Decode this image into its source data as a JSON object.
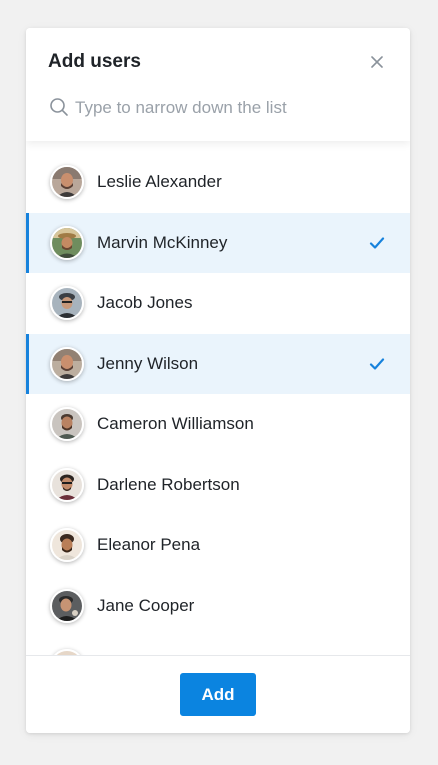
{
  "dialog": {
    "title": "Add users",
    "search_placeholder": "Type to narrow down the list",
    "add_label": "Add"
  },
  "colors": {
    "accent": "#0b84e0",
    "selected_row_bg": "#eaf4fc",
    "selected_bar": "#1782dc"
  },
  "users": [
    {
      "name": "Leslie Alexander",
      "selected": false
    },
    {
      "name": "Marvin McKinney",
      "selected": true
    },
    {
      "name": "Jacob Jones",
      "selected": false
    },
    {
      "name": "Jenny Wilson",
      "selected": true
    },
    {
      "name": "Cameron Williamson",
      "selected": false
    },
    {
      "name": "Darlene Robertson",
      "selected": false
    },
    {
      "name": "Eleanor Pena",
      "selected": false
    },
    {
      "name": "Jane Cooper",
      "selected": false
    },
    {
      "name": "",
      "selected": false
    }
  ]
}
